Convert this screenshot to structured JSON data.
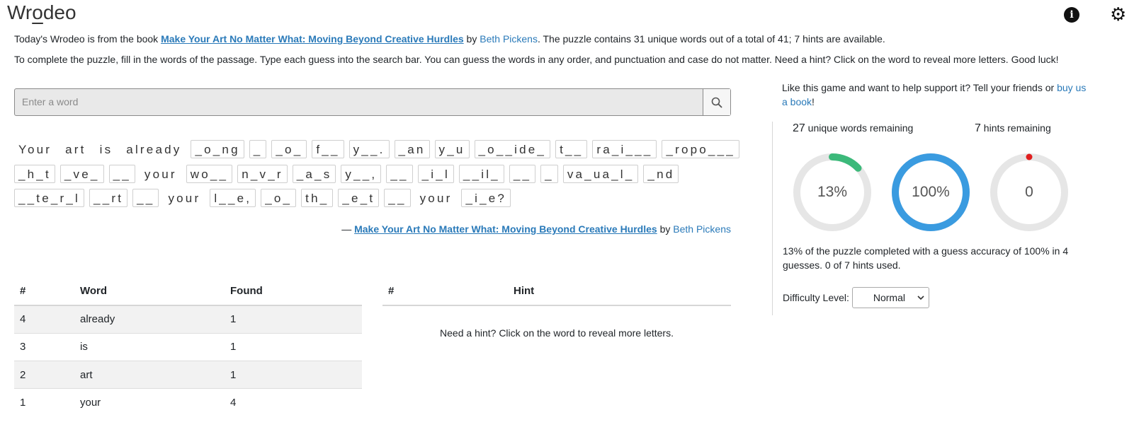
{
  "header": {
    "title_before": "Wr",
    "title_underlined": "o",
    "title_after": "deo",
    "info_icon": "info-icon",
    "settings_icon": "gear-icon"
  },
  "intro": {
    "line1_prefix": "Today's Wrodeo is from the book ",
    "book_title": "Make Your Art No Matter What: Moving Beyond Creative Hurdles",
    "by": " by ",
    "author": "Beth Pickens",
    "line1_suffix": ". The puzzle contains 31 unique words out of a total of 41; 7 hints are available.",
    "line2": "To complete the puzzle, fill in the words of the passage. Type each guess into the search bar. You can guess the words in any order, and punctuation and case do not matter. Need a hint? Click on the word to reveal more letters. Good luck!"
  },
  "search": {
    "placeholder": "Enter a word",
    "icon": "search-icon"
  },
  "passage": {
    "lines": [
      [
        {
          "t": "Your",
          "k": true
        },
        {
          "t": "art",
          "k": true
        },
        {
          "t": "is",
          "k": true
        },
        {
          "t": "already",
          "k": true
        },
        {
          "t": "_o_ng",
          "k": false
        },
        {
          "t": "_",
          "k": false
        },
        {
          "t": "_o_",
          "k": false
        },
        {
          "t": "f__",
          "k": false
        },
        {
          "t": "y__.",
          "k": false
        },
        {
          "t": "_an",
          "k": false
        },
        {
          "t": "y_u",
          "k": false
        },
        {
          "t": "_o__ide_",
          "k": false
        },
        {
          "t": "t__",
          "k": false
        },
        {
          "t": "ra_i___",
          "k": false
        },
        {
          "t": "_ropo___",
          "k": false
        }
      ],
      [
        {
          "t": "_h_t",
          "k": false
        },
        {
          "t": "_ve_",
          "k": false
        },
        {
          "t": "__",
          "k": false
        },
        {
          "t": "your",
          "k": true
        },
        {
          "t": "wo__",
          "k": false
        },
        {
          "t": "n_v_r",
          "k": false
        },
        {
          "t": "_a_s",
          "k": false
        },
        {
          "t": "y__,",
          "k": false
        },
        {
          "t": "__",
          "k": false
        },
        {
          "t": "_i_l",
          "k": false
        },
        {
          "t": "__il_",
          "k": false
        },
        {
          "t": "__",
          "k": false
        },
        {
          "t": "_",
          "k": false
        },
        {
          "t": "va_ua_l_",
          "k": false
        },
        {
          "t": "_nd",
          "k": false
        }
      ],
      [
        {
          "t": "__te_r_l",
          "k": false
        },
        {
          "t": "__rt",
          "k": false
        },
        {
          "t": "__",
          "k": false
        },
        {
          "t": "your",
          "k": true
        },
        {
          "t": "l__e,",
          "k": false
        },
        {
          "t": "_o_",
          "k": false
        },
        {
          "t": "th_",
          "k": false
        },
        {
          "t": "_e_t",
          "k": false
        },
        {
          "t": "__",
          "k": false
        },
        {
          "t": "your",
          "k": true
        },
        {
          "t": "_i_e?",
          "k": false
        }
      ]
    ],
    "attribution_dash": "— ",
    "attribution_title": "Make Your Art No Matter What: Moving Beyond Creative Hurdles",
    "attribution_by": " by ",
    "attribution_author": "Beth Pickens"
  },
  "words_table": {
    "headers": [
      "#",
      "Word",
      "Found"
    ],
    "rows": [
      [
        "4",
        "already",
        "1"
      ],
      [
        "3",
        "is",
        "1"
      ],
      [
        "2",
        "art",
        "1"
      ],
      [
        "1",
        "your",
        "4"
      ]
    ]
  },
  "hints_table": {
    "headers": [
      "#",
      "Hint"
    ],
    "empty_message": "Need a hint? Click on the word to reveal more letters."
  },
  "sidebar": {
    "support_text": "Like this game and want to help support it? Tell your friends or ",
    "support_link": "buy us a book",
    "support_end": "!",
    "unique_remaining_num": "27",
    "unique_remaining_label": " unique words remaining",
    "hints_remaining_num": "7",
    "hints_remaining_label": " hints remaining",
    "rings": [
      {
        "label": "13%",
        "fraction": 0.13,
        "color": "#3cb97a"
      },
      {
        "label": "100%",
        "fraction": 1.0,
        "color": "#3a9be0"
      },
      {
        "label": "0",
        "fraction": 0.0,
        "color": "#e01e1e"
      }
    ],
    "summary": "13% of the puzzle completed with a guess accuracy of 100% in 4 guesses. 0 of 7 hints used.",
    "difficulty_label": "Difficulty Level:",
    "difficulty_value": "Normal"
  }
}
